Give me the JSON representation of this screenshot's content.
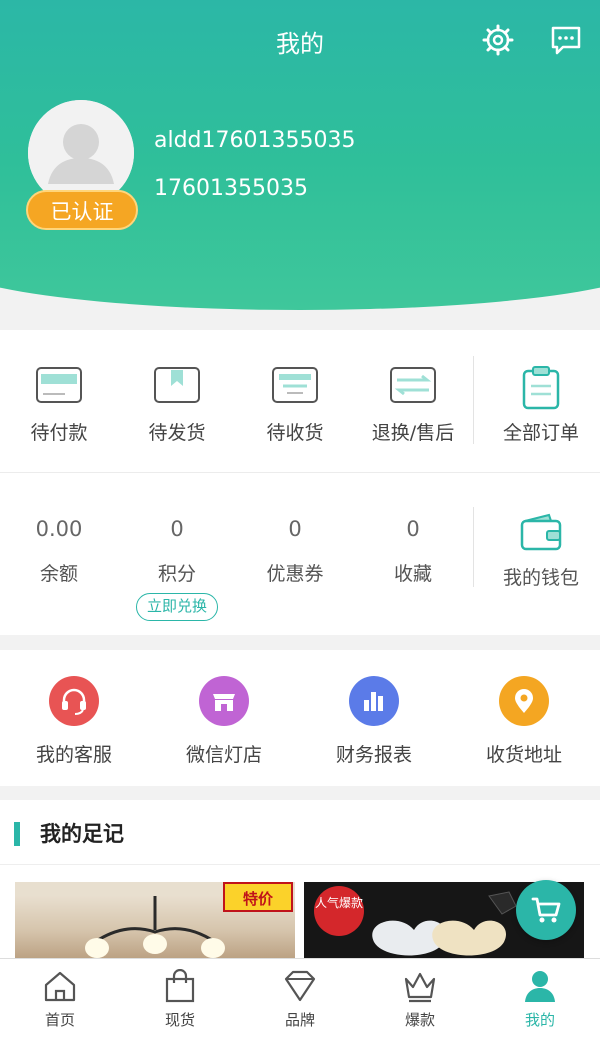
{
  "header": {
    "title": "我的",
    "settings_icon": "gear-icon",
    "message_icon": "message-icon",
    "verified_label": "已认证",
    "username": "aldd17601355035",
    "phone": "17601355035"
  },
  "orders": [
    {
      "label": "待付款",
      "icon": "wallet-card-icon"
    },
    {
      "label": "待发货",
      "icon": "package-icon"
    },
    {
      "label": "待收货",
      "icon": "box-icon"
    },
    {
      "label": "退换/售后",
      "icon": "return-icon"
    },
    {
      "label": "全部订单",
      "icon": "clipboard-icon"
    }
  ],
  "assets": [
    {
      "value": "0.00",
      "label": "余额"
    },
    {
      "value": "0",
      "label": "积分"
    },
    {
      "value": "0",
      "label": "优惠券"
    },
    {
      "value": "0",
      "label": "收藏"
    }
  ],
  "redeem_label": "立即兑换",
  "wallet_label": "我的钱包",
  "services": [
    {
      "label": "我的客服",
      "icon": "headset-icon",
      "color": "#e85454"
    },
    {
      "label": "微信灯店",
      "icon": "store-icon",
      "color": "#c064d4"
    },
    {
      "label": "财务报表",
      "icon": "bar-chart-icon",
      "color": "#5b7be8"
    },
    {
      "label": "收货地址",
      "icon": "location-pin-icon",
      "color": "#f4a622"
    }
  ],
  "footprint": {
    "title": "我的足记",
    "product_1_tag": "特价",
    "product_2_tag": "人气爆款"
  },
  "nav": [
    {
      "label": "首页",
      "icon": "home-icon"
    },
    {
      "label": "现货",
      "icon": "shopping-bag-icon"
    },
    {
      "label": "品牌",
      "icon": "diamond-icon"
    },
    {
      "label": "爆款",
      "icon": "crown-icon"
    },
    {
      "label": "我的",
      "icon": "user-icon",
      "active": true
    }
  ],
  "colors": {
    "accent": "#2bb6a8",
    "verified": "#f5a623"
  }
}
